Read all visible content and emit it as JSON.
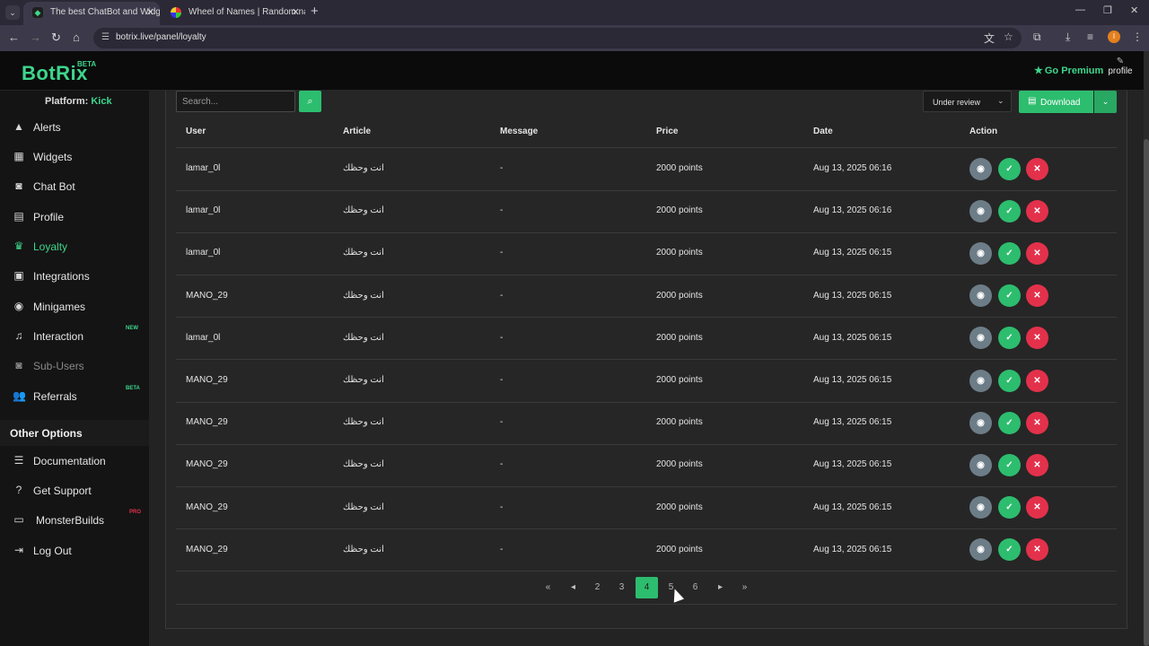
{
  "browser": {
    "tabs": [
      {
        "title": "The best ChatBot and Widgets",
        "active": true
      },
      {
        "title": "Wheel of Names | Random nam",
        "active": false
      }
    ],
    "url": "botrix.live/panel/loyalty",
    "profile_initial": "I"
  },
  "header": {
    "logo": "BotRix",
    "logo_badge": "BETA",
    "premium_label": "Go Premium",
    "profile_label": "profile"
  },
  "sidebar": {
    "platform_label": "Platform:",
    "platform_value": "Kick",
    "items": [
      {
        "label": "Alerts",
        "icon": "warning-icon"
      },
      {
        "label": "Widgets",
        "icon": "grid-icon"
      },
      {
        "label": "Chat Bot",
        "icon": "robot-icon"
      },
      {
        "label": "Profile",
        "icon": "id-card-icon"
      },
      {
        "label": "Loyalty",
        "icon": "trophy-icon",
        "active": true
      },
      {
        "label": "Integrations",
        "icon": "window-icon"
      },
      {
        "label": "Minigames",
        "icon": "gamepad-icon"
      },
      {
        "label": "Interaction",
        "icon": "music-icon",
        "badge": "NEW"
      },
      {
        "label": "Sub-Users",
        "icon": "robot-icon",
        "disabled": true
      },
      {
        "label": "Referrals",
        "icon": "users-icon",
        "badge": "BETA"
      }
    ],
    "other_options_title": "Other Options",
    "other_items": [
      {
        "label": "Documentation",
        "icon": "scroll-icon"
      },
      {
        "label": "Get Support",
        "icon": "question-icon"
      },
      {
        "label": "MonsterBuilds",
        "icon": "laptop-icon",
        "badge": "PRO"
      },
      {
        "label": "Log Out",
        "icon": "logout-icon"
      }
    ]
  },
  "toolbar": {
    "search_placeholder": "Search...",
    "status_filter": "Under review",
    "download_label": "Download"
  },
  "table": {
    "columns": [
      "User",
      "Article",
      "Message",
      "Price",
      "Date",
      "Action"
    ],
    "rows": [
      {
        "user": "lamar_0l",
        "article": "انت وحظك",
        "message": "-",
        "price": "2000 points",
        "date": "Aug 13, 2025 06:16"
      },
      {
        "user": "lamar_0l",
        "article": "انت وحظك",
        "message": "-",
        "price": "2000 points",
        "date": "Aug 13, 2025 06:16"
      },
      {
        "user": "lamar_0l",
        "article": "انت وحظك",
        "message": "-",
        "price": "2000 points",
        "date": "Aug 13, 2025 06:15"
      },
      {
        "user": "MANO_29",
        "article": "انت وحظك",
        "message": "-",
        "price": "2000 points",
        "date": "Aug 13, 2025 06:15"
      },
      {
        "user": "lamar_0l",
        "article": "انت وحظك",
        "message": "-",
        "price": "2000 points",
        "date": "Aug 13, 2025 06:15"
      },
      {
        "user": "MANO_29",
        "article": "انت وحظك",
        "message": "-",
        "price": "2000 points",
        "date": "Aug 13, 2025 06:15"
      },
      {
        "user": "MANO_29",
        "article": "انت وحظك",
        "message": "-",
        "price": "2000 points",
        "date": "Aug 13, 2025 06:15"
      },
      {
        "user": "MANO_29",
        "article": "انت وحظك",
        "message": "-",
        "price": "2000 points",
        "date": "Aug 13, 2025 06:15"
      },
      {
        "user": "MANO_29",
        "article": "انت وحظك",
        "message": "-",
        "price": "2000 points",
        "date": "Aug 13, 2025 06:15"
      },
      {
        "user": "MANO_29",
        "article": "انت وحظك",
        "message": "-",
        "price": "2000 points",
        "date": "Aug 13, 2025 06:15"
      }
    ]
  },
  "pagination": {
    "pages": [
      "2",
      "3",
      "4",
      "5",
      "6"
    ],
    "current": "4"
  },
  "colors": {
    "accent": "#3dd68c",
    "button_green": "#2dbd6e",
    "reject_red": "#e3314b",
    "view_gray": "#6d7d87"
  }
}
